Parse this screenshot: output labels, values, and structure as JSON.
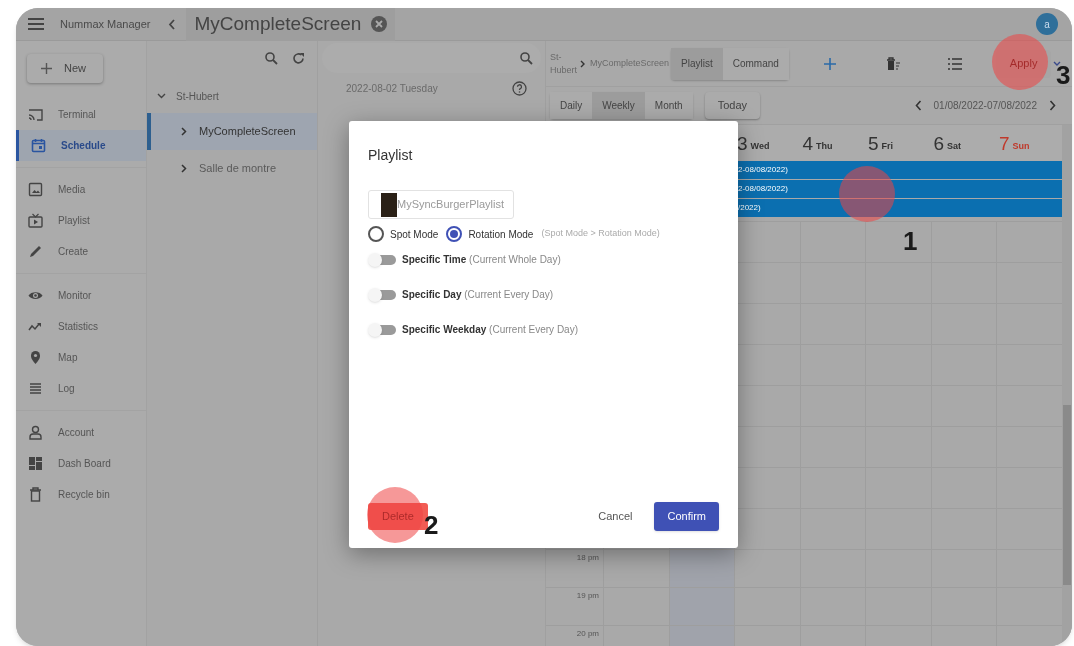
{
  "top_bar": {
    "app_name": "Nummax Manager",
    "tab": "MyCompleteScreen",
    "avatar": "a"
  },
  "sidebar": {
    "new_button": "New",
    "sections": [
      {
        "items": [
          {
            "label": "Terminal",
            "selected": false
          },
          {
            "label": "Schedule",
            "selected": true
          }
        ]
      },
      {
        "items": [
          {
            "label": "Media",
            "selected": false
          },
          {
            "label": "Playlist",
            "selected": false
          },
          {
            "label": "Create",
            "selected": false
          }
        ]
      },
      {
        "items": [
          {
            "label": "Monitor",
            "selected": false
          },
          {
            "label": "Statistics",
            "selected": false
          },
          {
            "label": "Map",
            "selected": false
          },
          {
            "label": "Log",
            "selected": false
          }
        ]
      },
      {
        "items": [
          {
            "label": "Account",
            "selected": false
          },
          {
            "label": "Dash Board",
            "selected": false
          },
          {
            "label": "Recycle bin",
            "selected": false
          }
        ]
      }
    ]
  },
  "tree": {
    "label": "St-Hubert",
    "expanded": true,
    "children": [
      {
        "label": "MyCompleteScreen",
        "selected": true
      },
      {
        "label": "Salle de montre",
        "selected": false
      }
    ]
  },
  "schedule_list": {
    "date": "2022-08-02 Tuesday"
  },
  "calendar": {
    "breadcrumb": [
      "St-Hubert",
      "MyCompleteScreen"
    ],
    "mode_tabs": [
      {
        "label": "Playlist",
        "selected": true
      },
      {
        "label": "Command",
        "selected": false
      }
    ],
    "apply_button": "Apply",
    "views": [
      {
        "label": "Daily",
        "selected": false
      },
      {
        "label": "Weekly",
        "selected": true
      },
      {
        "label": "Month",
        "selected": false
      }
    ],
    "today_button": "Today",
    "range": "01/08/2022-07/08/2022",
    "days": [
      {
        "number": "3",
        "name": "Wed",
        "color": "#333333"
      },
      {
        "number": "4",
        "name": "Thu",
        "color": "#333333"
      },
      {
        "number": "5",
        "name": "Fri",
        "color": "#333333"
      },
      {
        "number": "6",
        "name": "Sat",
        "color": "#333333"
      },
      {
        "number": "7",
        "name": "Sun",
        "color": "#c0392b"
      }
    ],
    "events": [
      {
        "text": "2-08/08/2022)"
      },
      {
        "text": "2-08/08/2022)"
      },
      {
        "text": "/2022)"
      }
    ],
    "times": [
      "18 pm",
      "19 pm",
      "20 pm"
    ]
  },
  "dialog": {
    "title": "Playlist",
    "playlist_field": "MySyncBurgerPlaylist",
    "modes": [
      {
        "label": "Spot Mode",
        "selected": false
      },
      {
        "label": "Rotation Mode",
        "selected": true
      }
    ],
    "mode_hint": "(Spot Mode > Rotation Mode)",
    "switches": [
      {
        "label": "Specific Time",
        "hint": "(Current Whole Day)",
        "on": false
      },
      {
        "label": "Specific Day",
        "hint": "(Current Every Day)",
        "on": false
      },
      {
        "label": "Specific Weekday",
        "hint": "(Current Every Day)",
        "on": false
      }
    ],
    "delete_button": "Delete",
    "cancel_button": "Cancel",
    "confirm_button": "Confirm"
  },
  "annotations": [
    {
      "number": "1"
    },
    {
      "number": "2"
    },
    {
      "number": "3"
    }
  ]
}
